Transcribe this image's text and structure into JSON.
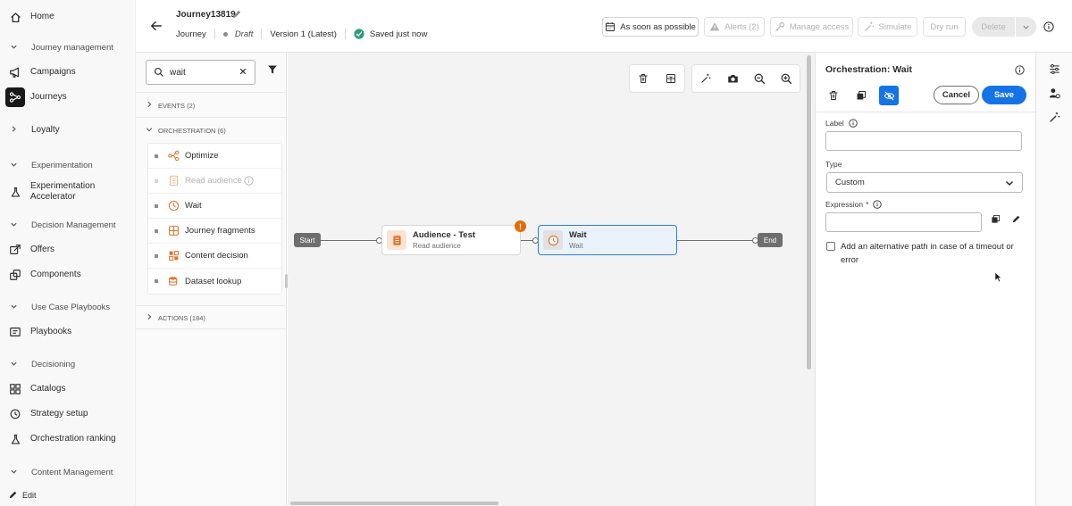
{
  "nav": {
    "items": [
      {
        "type": "item",
        "label": "Home",
        "icon": "home-icon"
      },
      {
        "type": "section",
        "label": "Journey management"
      },
      {
        "type": "item",
        "label": "Campaigns",
        "icon": "megaphone-icon"
      },
      {
        "type": "item",
        "label": "Journeys",
        "icon": "journey-icon",
        "active": true
      },
      {
        "type": "section",
        "label": "Loyalty",
        "collapsed": true
      },
      {
        "type": "section",
        "label": "Experimentation"
      },
      {
        "type": "item",
        "label": "Experimentation Accelerator",
        "icon": "beaker-icon"
      },
      {
        "type": "section",
        "label": "Decision Management"
      },
      {
        "type": "item",
        "label": "Offers",
        "icon": "offers-icon"
      },
      {
        "type": "item",
        "label": "Components",
        "icon": "components-icon"
      },
      {
        "type": "section",
        "label": "Use Case Playbooks"
      },
      {
        "type": "item",
        "label": "Playbooks",
        "icon": "playbook-icon"
      },
      {
        "type": "section",
        "label": "Decisioning"
      },
      {
        "type": "item",
        "label": "Catalogs",
        "icon": "catalog-icon"
      },
      {
        "type": "item",
        "label": "Strategy setup",
        "icon": "strategy-icon"
      },
      {
        "type": "item",
        "label": "Orchestration ranking",
        "icon": "beaker-icon"
      },
      {
        "type": "section",
        "label": "Content Management"
      }
    ],
    "edit_label": "Edit"
  },
  "header": {
    "journey_name": "Journey13819",
    "type_label": "Journey",
    "status": "Draft",
    "version": "Version 1 (Latest)",
    "saved_status": "Saved just now",
    "buttons": {
      "schedule": "As soon as possible",
      "alerts": "Alerts (2)",
      "manage_access": "Manage access",
      "simulate": "Simulate",
      "dry_run": "Dry run",
      "delete": "Delete"
    }
  },
  "palette": {
    "search_value": "wait",
    "categories": {
      "events": "EVENTS (2)",
      "orchestration": "ORCHESTRATION (6)",
      "actions": "ACTIONS (184)"
    },
    "orchestration_items": [
      {
        "label": "Optimize",
        "icon": "optimize-icon",
        "disabled": false
      },
      {
        "label": "Read audience",
        "icon": "read-audience-icon",
        "disabled": true
      },
      {
        "label": "Wait",
        "icon": "clock-icon",
        "disabled": false
      },
      {
        "label": "Journey fragments",
        "icon": "fragments-icon",
        "disabled": false
      },
      {
        "label": "Content decision",
        "icon": "content-decision-icon",
        "disabled": false
      },
      {
        "label": "Dataset lookup",
        "icon": "dataset-lookup-icon",
        "disabled": false
      }
    ]
  },
  "canvas": {
    "start_label": "Start",
    "end_label": "End",
    "audience_node": {
      "title": "Audience - Test",
      "subtitle": "Read audience"
    },
    "wait_node": {
      "title": "Wait",
      "subtitle": "Wait"
    },
    "warning_mark": "!"
  },
  "panel": {
    "title": "Orchestration: Wait",
    "cancel_label": "Cancel",
    "save_label": "Save",
    "label_field": {
      "label": "Label",
      "value": ""
    },
    "type_field": {
      "label": "Type",
      "value": "Custom"
    },
    "expression_field": {
      "label": "Expression",
      "required_mark": "*",
      "value": ""
    },
    "timeout_checkbox": {
      "label": "Add an alternative path in case of a timeout or error",
      "checked": false
    }
  },
  "colors": {
    "accent": "#1473e6",
    "selected_node_bg": "#eaf3fd",
    "warning": "#e36a0b",
    "orange_icon": "#e0712b",
    "saved_green": "#2d9d78"
  }
}
